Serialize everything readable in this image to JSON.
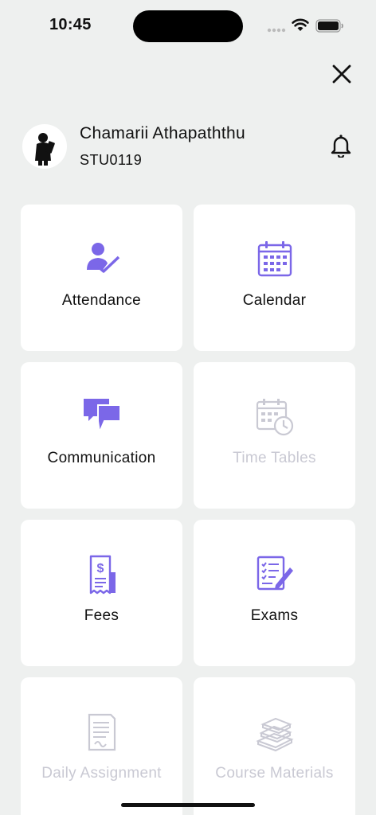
{
  "status_bar": {
    "time": "10:45"
  },
  "profile": {
    "name": "Chamarii Athapaththu",
    "student_id": "STU0119"
  },
  "colors": {
    "accent": "#7b67e8",
    "disabled": "#c9c9d3",
    "background": "#eef0ef"
  },
  "tiles": [
    {
      "label": "Attendance",
      "icon": "attendance-icon",
      "enabled": true
    },
    {
      "label": "Calendar",
      "icon": "calendar-icon",
      "enabled": true
    },
    {
      "label": "Communication",
      "icon": "chat-icon",
      "enabled": true
    },
    {
      "label": "Time Tables",
      "icon": "timetable-icon",
      "enabled": false
    },
    {
      "label": "Fees",
      "icon": "receipt-icon",
      "enabled": true
    },
    {
      "label": "Exams",
      "icon": "exam-icon",
      "enabled": true
    },
    {
      "label": "Daily Assignment",
      "icon": "assignment-icon",
      "enabled": false
    },
    {
      "label": "Course Materials",
      "icon": "books-icon",
      "enabled": false
    }
  ]
}
